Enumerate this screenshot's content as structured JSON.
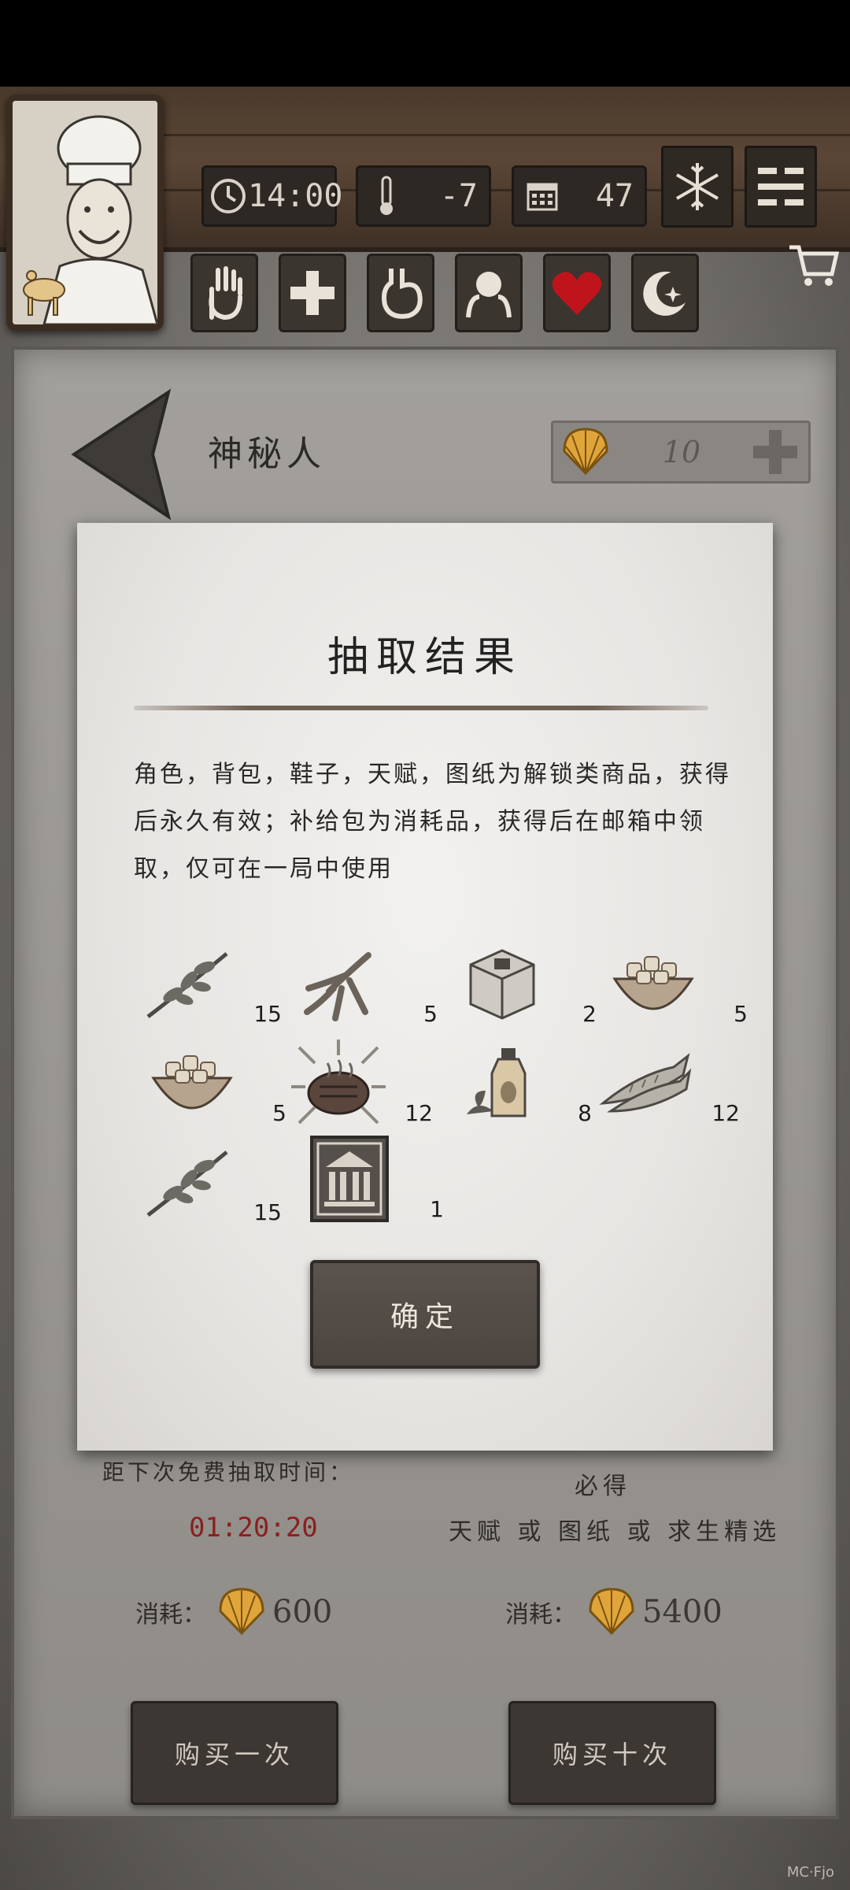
{
  "hud": {
    "time": "14:00",
    "temperature": "-7",
    "days": "47",
    "icons": [
      "clock-icon",
      "thermometer-icon",
      "calendar-icon",
      "snowflake-icon",
      "menu-icon"
    ]
  },
  "status_icons": [
    "hand-icon",
    "health-cross-icon",
    "stomach-icon",
    "head-icon",
    "heart-icon",
    "moon-icon"
  ],
  "shop": {
    "title": "神秘人",
    "currency_amount": "10"
  },
  "dialog": {
    "title": "抽取结果",
    "notice": "角色，背包，鞋子，天赋，图纸为解锁类商品，获得后永久有效；补给包为消耗品，获得后在邮箱中领取，仅可在一局中使用",
    "items": [
      {
        "icon": "herb-branch-icon",
        "count": "15"
      },
      {
        "icon": "ginseng-root-icon",
        "count": "5"
      },
      {
        "icon": "supply-box-icon",
        "count": "2"
      },
      {
        "icon": "nut-bowl-icon",
        "count": "5"
      },
      {
        "icon": "nut-bowl-icon",
        "count": "5"
      },
      {
        "icon": "grilled-meat-icon",
        "count": "12"
      },
      {
        "icon": "oil-bottle-icon",
        "count": "8"
      },
      {
        "icon": "dried-fish-icon",
        "count": "12"
      },
      {
        "icon": "herb-branch-icon",
        "count": "15"
      },
      {
        "icon": "blueprint-building-icon",
        "count": "1"
      }
    ],
    "confirm_label": "确定"
  },
  "draw": {
    "free_label": "距下次免费抽取时间：",
    "timer": "01:20:20",
    "guarantee_title": "必得",
    "guarantee_desc": "天赋 或 图纸 或 求生精选",
    "cost_label": "消耗：",
    "single_cost": "600",
    "ten_cost": "5400",
    "buy_once_label": "购买一次",
    "buy_ten_label": "购买十次"
  },
  "colors": {
    "timer": "#8b1f1f",
    "heart": "#c0141c",
    "shell": "#e0a53a"
  },
  "footer_mark": "MC·Fjo"
}
